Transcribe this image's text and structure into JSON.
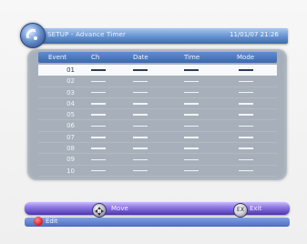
{
  "header": {
    "title": "SETUP - Advance Timer",
    "clock": "11/01/07 21:26",
    "logo_icon": "satellite-dish-icon",
    "color_top": "#a8c8f2",
    "color_bottom": "#3f6ab0"
  },
  "table": {
    "columns": [
      "Event",
      "Ch",
      "Date",
      "Time",
      "Mode"
    ],
    "rows": [
      {
        "event": "01",
        "ch": "",
        "date": "",
        "time": "",
        "mode": "",
        "selected": true
      },
      {
        "event": "02",
        "ch": "",
        "date": "",
        "time": "",
        "mode": ""
      },
      {
        "event": "03",
        "ch": "",
        "date": "",
        "time": "",
        "mode": ""
      },
      {
        "event": "04",
        "ch": "",
        "date": "",
        "time": "",
        "mode": ""
      },
      {
        "event": "05",
        "ch": "",
        "date": "",
        "time": "",
        "mode": ""
      },
      {
        "event": "06",
        "ch": "",
        "date": "",
        "time": "",
        "mode": ""
      },
      {
        "event": "07",
        "ch": "",
        "date": "",
        "time": "",
        "mode": ""
      },
      {
        "event": "08",
        "ch": "",
        "date": "",
        "time": "",
        "mode": ""
      },
      {
        "event": "09",
        "ch": "",
        "date": "",
        "time": "",
        "mode": ""
      },
      {
        "event": "10",
        "ch": "",
        "date": "",
        "time": "",
        "mode": ""
      }
    ],
    "panel_color": "#a7b0ba",
    "selected_color": "#f7f9fc"
  },
  "footer": {
    "move_label": "Move",
    "move_icon": "dpad-icon",
    "exit_label": "Exit",
    "exit_icon": "exit-button-icon",
    "exit_icon_text": "EX",
    "red_label": "Edit",
    "red_icon": "red-button-icon",
    "bar_color": "#8f79e8"
  }
}
